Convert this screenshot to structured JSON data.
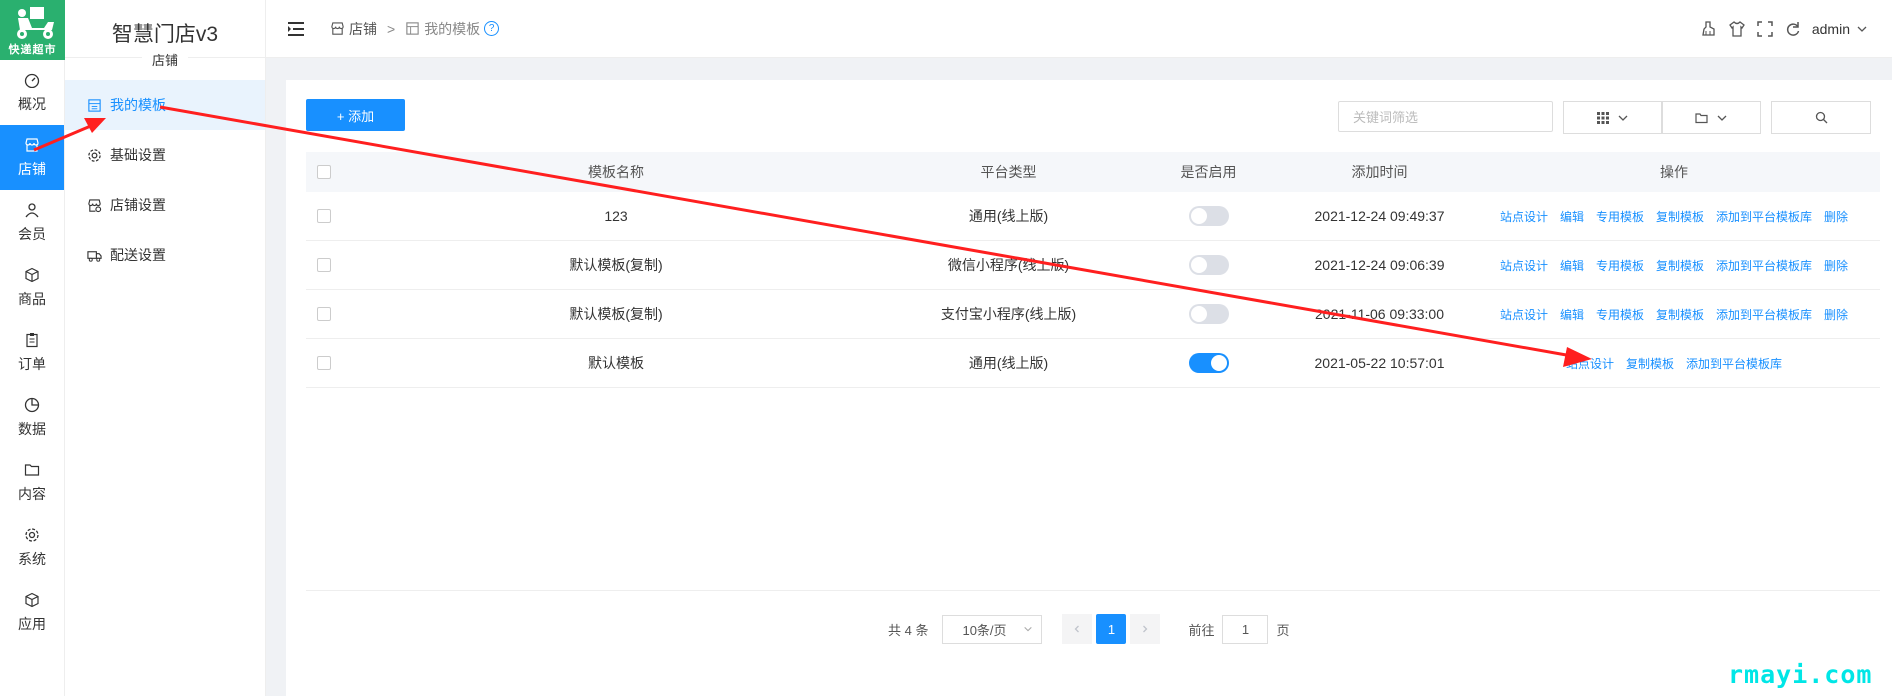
{
  "rail": {
    "logo_text": "快递超市",
    "items": [
      {
        "label": "概况",
        "icon": "dashboard-icon"
      },
      {
        "label": "店铺",
        "icon": "store-icon",
        "active": true
      },
      {
        "label": "会员",
        "icon": "user-icon"
      },
      {
        "label": "商品",
        "icon": "box-icon"
      },
      {
        "label": "订单",
        "icon": "clipboard-icon"
      },
      {
        "label": "数据",
        "icon": "pie-chart-icon"
      },
      {
        "label": "内容",
        "icon": "folder-icon"
      },
      {
        "label": "系统",
        "icon": "gear-icon"
      },
      {
        "label": "应用",
        "icon": "cube-icon"
      }
    ]
  },
  "sidebar": {
    "title": "智慧门店v3",
    "subtitle": "店铺",
    "items": [
      {
        "label": "我的模板",
        "icon": "template-icon",
        "active": true
      },
      {
        "label": "基础设置",
        "icon": "gear-icon"
      },
      {
        "label": "店铺设置",
        "icon": "store-settings-icon"
      },
      {
        "label": "配送设置",
        "icon": "truck-icon"
      }
    ]
  },
  "topbar": {
    "breadcrumb_root": "店铺",
    "breadcrumb_sep": ">",
    "breadcrumb_current": "我的模板",
    "help": "?",
    "user": "admin"
  },
  "toolbar": {
    "add_label": "+ 添加",
    "search_placeholder": "关键词筛选"
  },
  "table": {
    "headers": {
      "name": "模板名称",
      "platform": "平台类型",
      "enabled": "是否启用",
      "time": "添加时间",
      "ops": "操作"
    },
    "rows": [
      {
        "name": "123",
        "platform": "通用(线上版)",
        "enabled": false,
        "time": "2021-12-24 09:49:37",
        "ops": [
          "站点设计",
          "编辑",
          "专用模板",
          "复制模板",
          "添加到平台模板库",
          "删除"
        ]
      },
      {
        "name": "默认模板(复制)",
        "platform": "微信小程序(线上版)",
        "enabled": false,
        "time": "2021-12-24 09:06:39",
        "ops": [
          "站点设计",
          "编辑",
          "专用模板",
          "复制模板",
          "添加到平台模板库",
          "删除"
        ]
      },
      {
        "name": "默认模板(复制)",
        "platform": "支付宝小程序(线上版)",
        "enabled": false,
        "time": "2021-11-06 09:33:00",
        "ops": [
          "站点设计",
          "编辑",
          "专用模板",
          "复制模板",
          "添加到平台模板库",
          "删除"
        ]
      },
      {
        "name": "默认模板",
        "platform": "通用(线上版)",
        "enabled": true,
        "time": "2021-05-22 10:57:01",
        "ops": [
          "站点设计",
          "复制模板",
          "添加到平台模板库"
        ]
      }
    ]
  },
  "pagination": {
    "total": "共 4 条",
    "page_size": "10条/页",
    "current": "1",
    "goto_prefix": "前往",
    "goto_value": "1",
    "goto_suffix": "页"
  },
  "watermark": "rmayi.com",
  "colors": {
    "accent": "#1890ff",
    "arrow": "#ff1f1f",
    "logo_bg": "#2ab06f"
  }
}
